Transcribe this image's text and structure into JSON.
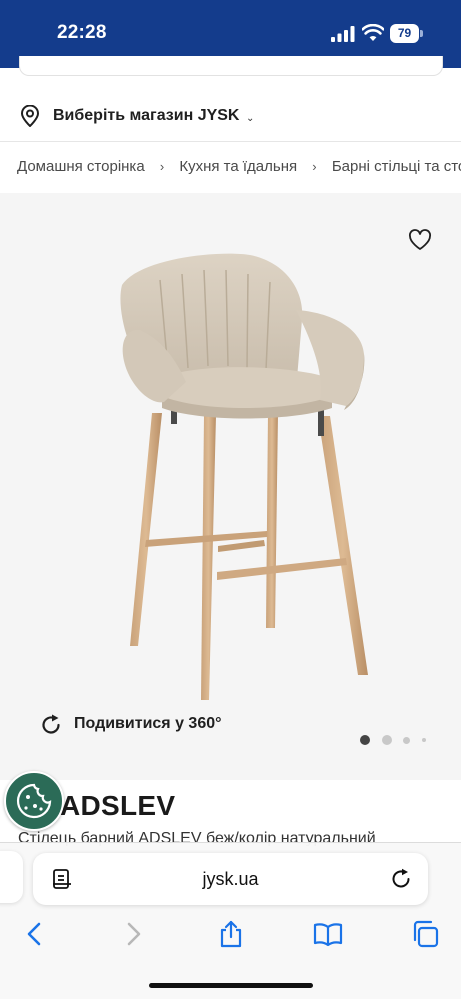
{
  "status_bar": {
    "time": "22:28",
    "battery": "79"
  },
  "header": {
    "store_selector": "Виберіть магазин JYSK",
    "breadcrumbs": [
      "Домашня сторінка",
      "Кухня та їдальня",
      "Барні стільці та столи"
    ]
  },
  "gallery": {
    "view_360_label": "Подивитися у 360°",
    "dots_total": 4,
    "active_dot": 1
  },
  "product": {
    "title": "ADSLEV",
    "subtitle": "Стілець барний ADSLEV беж/колір натуральний"
  },
  "browser": {
    "url": "jysk.ua"
  },
  "colors": {
    "header_bg": "#143c8c",
    "cookie_bg": "#2b6b57",
    "safari_blue": "#1a73e8"
  },
  "icons": [
    "location-pin-icon",
    "chevron-down-icon",
    "chevron-right-icon",
    "heart-icon",
    "rotate-360-icon",
    "cookie-icon",
    "reader-icon",
    "reload-icon",
    "back-icon",
    "forward-icon",
    "share-icon",
    "bookmarks-icon",
    "tabs-icon"
  ]
}
